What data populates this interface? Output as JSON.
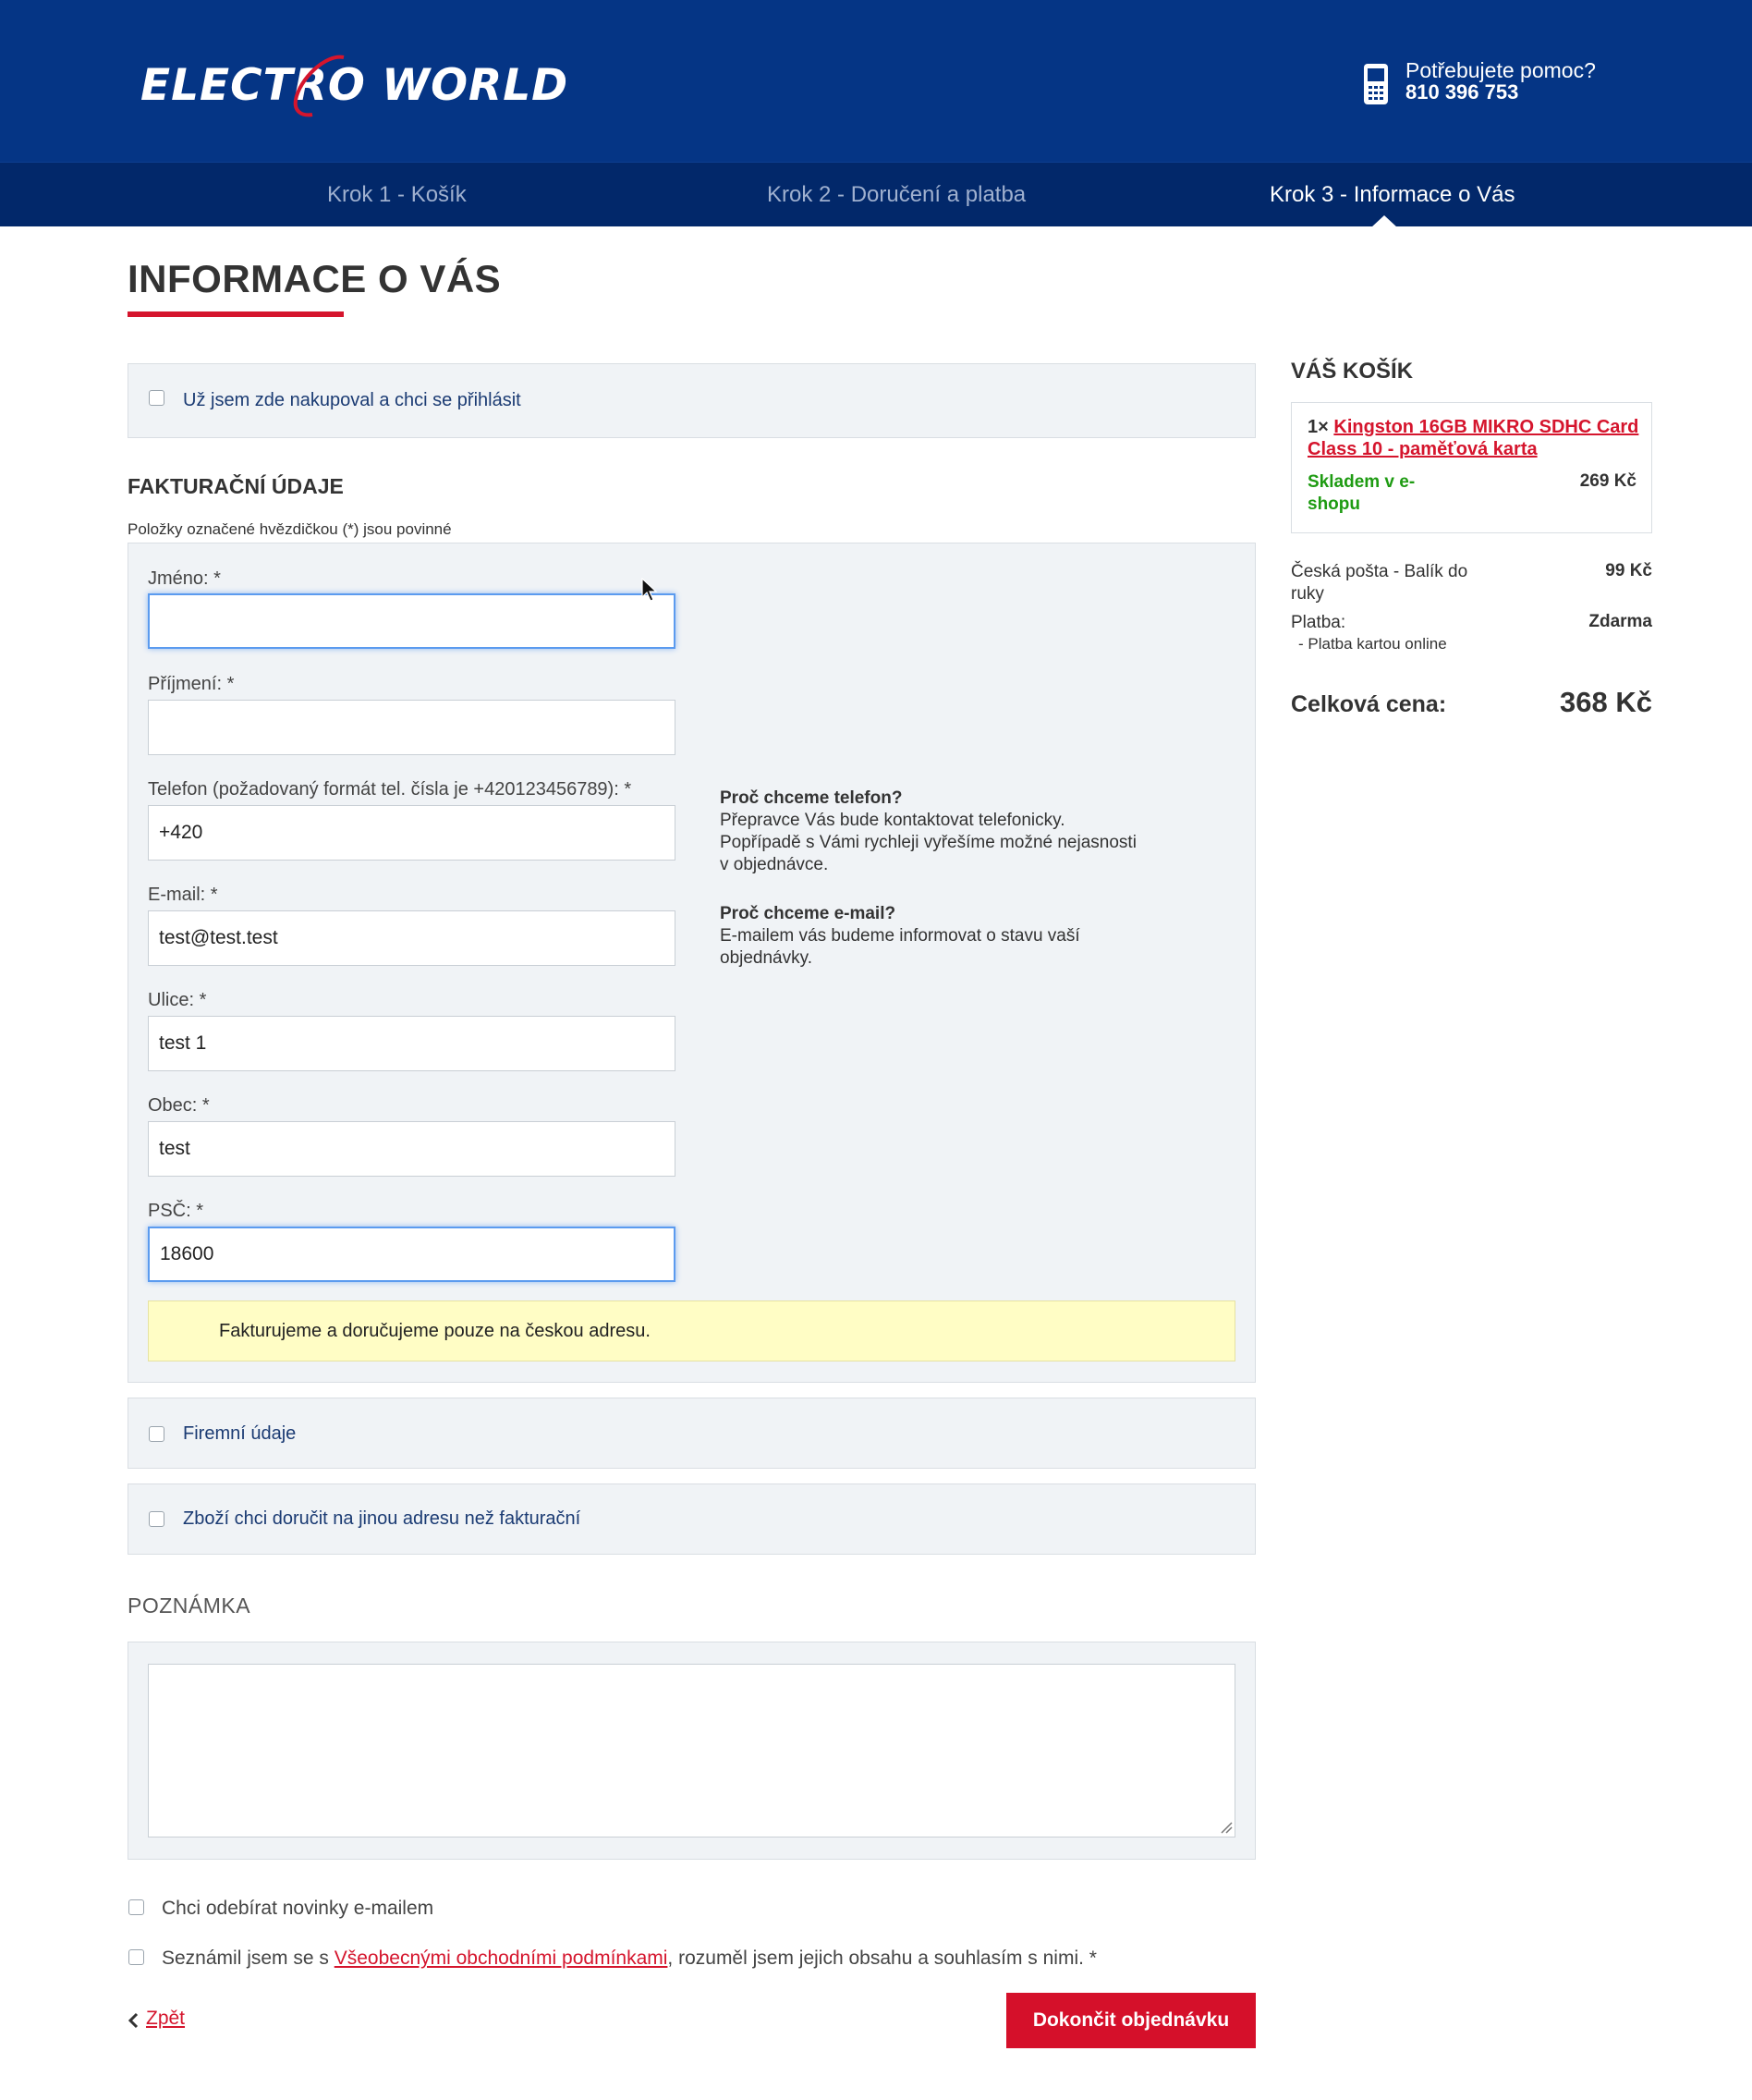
{
  "header": {
    "logo_text": "ELECTRO WORLD",
    "help_question": "Potřebujete pomoc?",
    "help_phone": "810 396 753"
  },
  "steps": [
    {
      "label": "Krok 1 - Košík"
    },
    {
      "label": "Krok 2 - Doručení a platba"
    },
    {
      "label": "Krok 3 - Informace o Vás"
    }
  ],
  "page": {
    "title": "INFORMACE O VÁS"
  },
  "login": {
    "label": "Už jsem zde nakupoval a chci se přihlásit"
  },
  "billing": {
    "title": "FAKTURAČNÍ ÚDAJE",
    "hint": "Položky označené hvězdičkou (*) jsou povinné",
    "fields": {
      "first_name": {
        "label": "Jméno: *",
        "value": ""
      },
      "last_name": {
        "label": "Příjmení: *",
        "value": ""
      },
      "phone": {
        "label": "Telefon (požadovaný formát tel. čísla je +420123456789): *",
        "value": "+420"
      },
      "email": {
        "label": "E-mail: *",
        "value": "test@test.test"
      },
      "street": {
        "label": "Ulice: *",
        "value": "test 1"
      },
      "city": {
        "label": "Obec: *",
        "value": "test"
      },
      "zip": {
        "label": "PSČ: *",
        "value": "18600"
      }
    },
    "info": {
      "phone_title": "Proč chceme telefon?",
      "phone_text": "Přepravce Vás bude kontaktovat telefonicky. Popřípadě s Vámi rychleji vyřešíme možné nejasnosti v objednávce.",
      "email_title": "Proč chceme e-mail?",
      "email_text": "E-mailem vás budeme informovat o stavu vaší objednávky."
    },
    "notice": "Fakturujeme a doručujeme pouze na českou adresu."
  },
  "company": {
    "label": "Firemní údaje"
  },
  "delivery_address": {
    "label": "Zboží chci doručit na jinou adresu než fakturační"
  },
  "note": {
    "title": "POZNÁMKA",
    "value": ""
  },
  "consents": {
    "newsletter": "Chci odebírat novinky e-mailem",
    "terms_prefix": "Seznámil jsem se s ",
    "terms_link": "Všeobecnými obchodními podmínkami",
    "terms_suffix": ", rozuměl jsem jejich obsahu a souhlasím s nimi. *"
  },
  "actions": {
    "back": "Zpět",
    "submit": "Dokončit objednávku"
  },
  "cart": {
    "title": "VÁŠ KOŠÍK",
    "item": {
      "qty": "1×",
      "name": "Kingston 16GB MIKRO SDHC Card Class 10 - paměťová karta",
      "stock": "Skladem v e-shopu",
      "price": "269 Kč"
    },
    "shipping_label": "Česká pošta - Balík do ruky",
    "shipping_price": "99 Kč",
    "payment_label": "Platba:",
    "payment_price": "Zdarma",
    "payment_method": "- Platba kartou online",
    "total_label": "Celková cena:",
    "total_value": "368 Kč"
  },
  "colors": {
    "header_bg": "#053585",
    "steps_bg": "#02286a",
    "accent_red": "#d5152d",
    "stock_green": "#1e9b12",
    "panel_bg": "#f0f3f6",
    "notice_bg": "#fffdc5"
  }
}
